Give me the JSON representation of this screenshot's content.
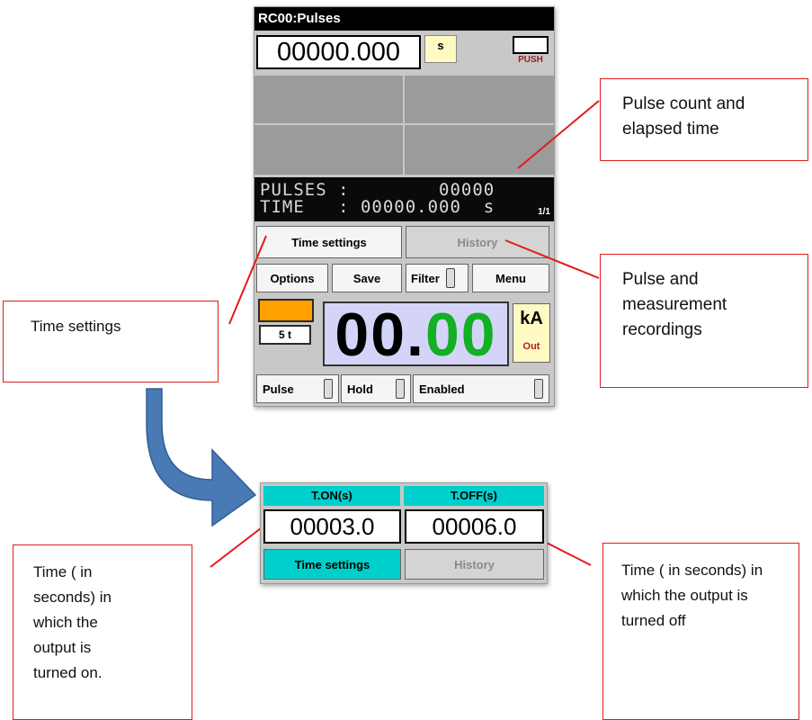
{
  "device": {
    "title": "RC00:Pulses",
    "timer_value": "00000.000",
    "timer_unit": "s",
    "push_label": "PUSH",
    "lcd": {
      "line1": "PULSES :        00000",
      "line2": "TIME   : 00000.000  s",
      "page": "1/1"
    },
    "tabs": {
      "time_settings": "Time settings",
      "history": "History"
    },
    "toolbar": {
      "options": "Options",
      "save": "Save",
      "filter": "Filter",
      "menu": "Menu"
    },
    "display": {
      "multiplier": "5 t",
      "value_int": "00.",
      "value_dec": "00",
      "unit": "kA",
      "unit_sub": "Out",
      "swatch_color": "#ff9f00"
    },
    "bottom": {
      "pulse": "Pulse",
      "hold": "Hold",
      "enabled": "Enabled"
    }
  },
  "zoom_panel": {
    "t_on_header": "T.ON(s)",
    "t_off_header": "T.OFF(s)",
    "t_on_value": "00003.0",
    "t_off_value": "00006.0",
    "tab_time_settings": "Time settings",
    "tab_history": "History"
  },
  "callouts": {
    "pulse_count": "Pulse count and elapsed time",
    "time_settings": "Time settings",
    "recordings": "Pulse and measurement recordings",
    "time_on": "Time ( in seconds) in which the output is  turned on.",
    "time_off": "Time ( in seconds) in which the output is turned off"
  },
  "colors": {
    "accent_cyan": "#00d0cc",
    "callout_border": "#e31a1a",
    "arrow": "#4a7ab5"
  }
}
